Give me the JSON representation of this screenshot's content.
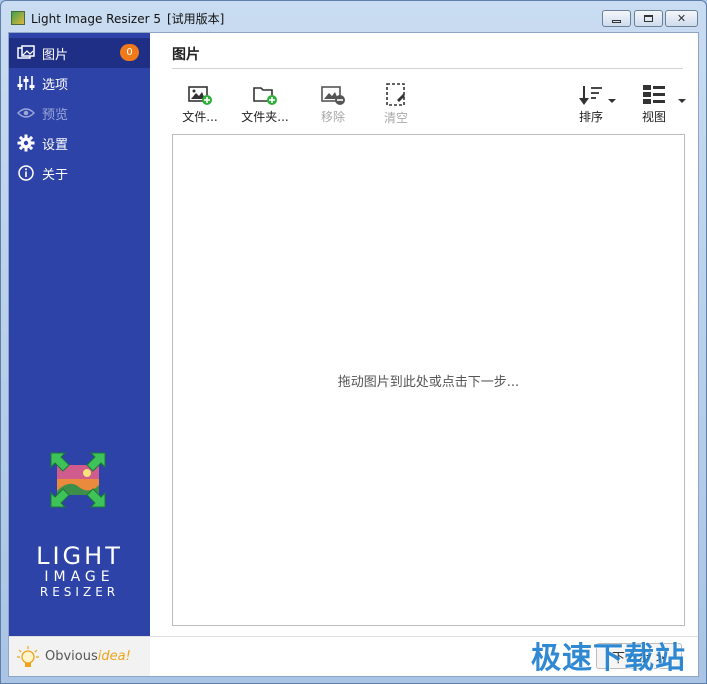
{
  "window": {
    "title": "Light Image Resizer 5",
    "trial": "[试用版本]"
  },
  "sidebar": {
    "items": [
      {
        "label": "图片",
        "icon": "images-icon",
        "badge": "0",
        "active": true
      },
      {
        "label": "选项",
        "icon": "sliders-icon"
      },
      {
        "label": "预览",
        "icon": "eye-icon",
        "disabled": true
      },
      {
        "label": "设置",
        "icon": "gear-icon"
      },
      {
        "label": "关于",
        "icon": "info-icon"
      }
    ],
    "logo": {
      "line1": "LIGHT",
      "line2": "IMAGE",
      "line3": "RESIZER"
    },
    "brand": {
      "part1": "Obvious",
      "part2": "idea!"
    }
  },
  "main": {
    "title": "图片",
    "toolbar": {
      "files": "文件...",
      "folder": "文件夹...",
      "remove": "移除",
      "clear": "清空",
      "sort": "排序",
      "view": "视图"
    },
    "drop_hint": "拖动图片到此处或点击下一步...",
    "next_button": "下一步 >"
  },
  "watermark": "极速下载站",
  "colors": {
    "sidebar": "#2e43a8",
    "sidebar_active": "#1f2f86",
    "badge": "#f07a1a",
    "add_green": "#2fae3a",
    "watermark": "#1e7fd0"
  }
}
